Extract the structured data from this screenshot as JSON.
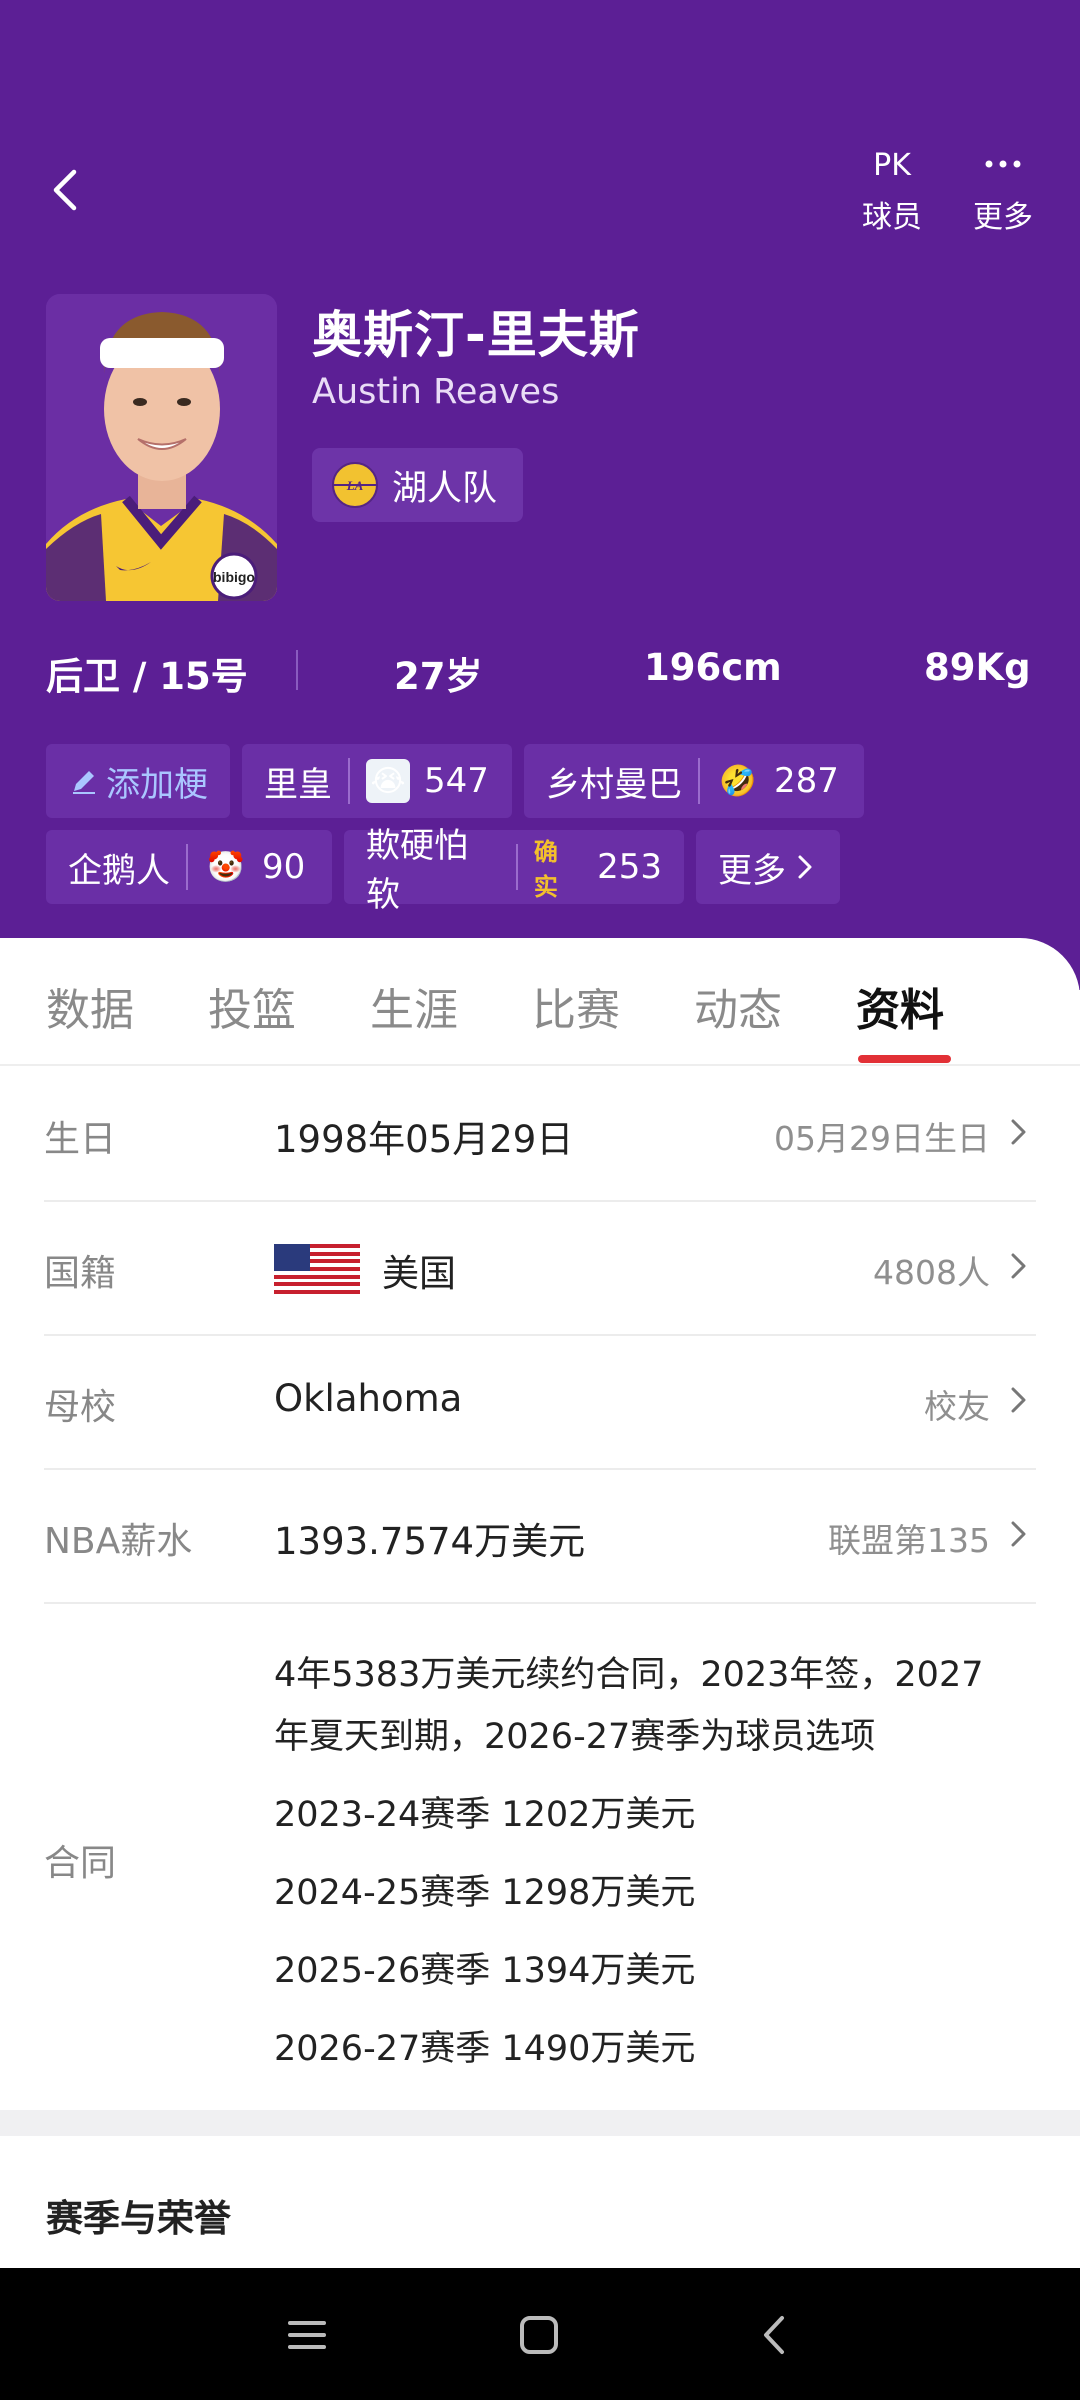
{
  "header": {
    "top_actions": [
      {
        "icon": "pk-icon",
        "label": "球员"
      },
      {
        "icon": "more-icon",
        "label": "更多"
      }
    ],
    "pk_glyph": "PK",
    "player": {
      "name_cn": "奥斯汀-里夫斯",
      "name_en": "Austin Reaves",
      "team": "湖人队",
      "jersey_sponsor": "bibigo"
    },
    "stats": {
      "position_number": "后卫 / 15号",
      "age": "27岁",
      "height": "196cm",
      "weight": "89Kg"
    },
    "tags": [
      {
        "label": "添加梗"
      },
      {
        "label": "里皇",
        "count": "547"
      },
      {
        "label": "乡村曼巴",
        "count": "287"
      },
      {
        "label": "企鹅人",
        "count": "90"
      },
      {
        "label": "欺硬怕软",
        "badge": "确实",
        "count": "253"
      },
      {
        "label": "更多"
      }
    ]
  },
  "tabs": [
    "数据",
    "投篮",
    "生涯",
    "比赛",
    "动态",
    "资料"
  ],
  "active_tab": "资料",
  "profile": {
    "birthday": {
      "label": "生日",
      "value": "1998年05月29日",
      "right": "05月29日生日"
    },
    "nationality": {
      "label": "国籍",
      "value": "美国",
      "right": "4808人"
    },
    "school": {
      "label": "母校",
      "value": "Oklahoma",
      "right": "校友"
    },
    "salary": {
      "label": "NBA薪水",
      "value": "1393.7574万美元",
      "right": "联盟第135"
    },
    "contract": {
      "label": "合同",
      "summary_line1": "4年5383万美元续约合同，2023年签，2027",
      "summary_line2": "年夏天到期，2026-27赛季为球员选项",
      "seasons": [
        "2023-24赛季 1202万美元",
        "2024-25赛季 1298万美元",
        "2025-26赛季 1394万美元",
        "2026-27赛季 1490万美元"
      ]
    }
  },
  "section_title": "赛季与荣誉",
  "colors": {
    "header_bg": "#5c1f95",
    "tab_accent": "#e23036"
  }
}
